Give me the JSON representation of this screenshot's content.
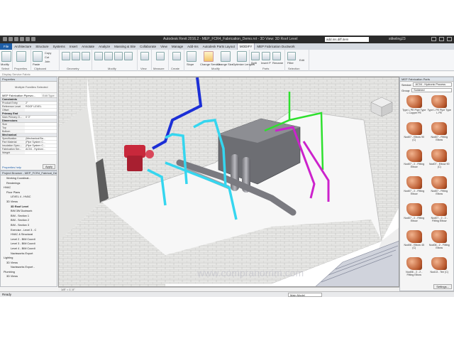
{
  "title_bar": {
    "title": "Autodesk Revit 2016.2 - MEP_FCR4_Fabrication_Demo.rvt - 3D View: 3D Roof Level",
    "search": "add.ins.diff.item",
    "user": "stikeling23"
  },
  "ribbon_tabs": [
    "File",
    "Architecture",
    "Structure",
    "Systems",
    "Insert",
    "Annotate",
    "Analyze",
    "Massing & Site",
    "Collaborate",
    "View",
    "Manage",
    "Add-Ins",
    "Autodesk Parts Layout",
    "MODIFY",
    "MEP Fabrication Ductwork"
  ],
  "ribbon": {
    "modify": "Modify",
    "copy": "Copy",
    "cut": "Cut",
    "join": "Join",
    "paste": "Paste",
    "groups": [
      "Select",
      "Properties",
      "Clipboard",
      "Geometry",
      "Modify",
      "View",
      "Measure",
      "Create",
      "Modify",
      "Parts",
      "Selection"
    ],
    "slope": "Slope",
    "change_service": "Change Service",
    "change_size": "Change Size",
    "optimize_lengths": "Optimize Lengths",
    "parts": [
      "Split",
      "Insert Points",
      "Rename Parts"
    ],
    "filter": "Filter",
    "edit": "Edit",
    "select_label": "Select"
  },
  "options_bar": "Display Service Fabric",
  "properties": {
    "title": "Properties",
    "type_selector": "Multiple Families Selected",
    "filter": "MEP Fabrication Pipewo...",
    "edit_type": "Edit Type",
    "sections": {
      "constraints": "Constraints",
      "primary_end": "Primary End",
      "dimensions": "Dimensions",
      "mechanical": "Mechanical"
    },
    "rows": [
      {
        "k": "Product Entry",
        "v": "2\""
      },
      {
        "k": "Reference Level",
        "v": "ROOF LEVEL"
      },
      {
        "k": "Offset",
        "v": ""
      }
    ],
    "primary_rows": [
      {
        "k": "Main Primary O...",
        "v": "0' 0\""
      }
    ],
    "dim_rows": [
      {
        "k": "Size",
        "v": ""
      },
      {
        "k": "Top",
        "v": ""
      },
      {
        "k": "Bottom",
        "v": ""
      }
    ],
    "mech_rows": [
      {
        "k": "Specification",
        "v": "(Mechanical Ba..."
      },
      {
        "k": "Part Material",
        "v": "(Pipe System C..."
      },
      {
        "k": "Insulation Spec...",
        "v": "(Pipe System C..."
      },
      {
        "k": "Fabrication Ser...",
        "v": "AC04 - Hydroni..."
      },
      {
        "k": "Weight",
        "v": ""
      }
    ],
    "help": "Properties help",
    "apply": "Apply"
  },
  "project_browser": {
    "title": "Project Browser - MEP_FCR4_Fabricat_Demo.rvt",
    "items": [
      "Working Coordinat...",
      "Renderings",
      "HVAC",
      "Floor Plans",
      "LEVEL 4 - HVAC",
      "3D Views",
      "3D Roof Level",
      "BIM 3W Ductwork",
      "BIM - Section 1",
      "BIM - Section 2",
      "BIM - Section 3",
      "Exercise - Level 3 - C",
      "HVAC & Structural",
      "Level 2 - BIM Coordi",
      "Level 3 - BIM Coordi",
      "Level 4 - BIM Coordi",
      "Navisworks Export",
      "Lighting",
      "3D Views",
      "Navisworks Export -",
      "Plumbing",
      "3D Views"
    ]
  },
  "fab_parts": {
    "title": "MEP Fabrication Parts",
    "service_label": "Service:",
    "service_value": "AC04 - Hydronic Process",
    "group_label": "Group:",
    "group_value": "Soldered",
    "items": [
      "Type L PE Pipe Type L Copper PE",
      "Type L PE Pipe Type L PE",
      "Nod07 - Elbow 90 (C)",
      "Nod07 - Fitting Elbow",
      "Nod07 - 2 - Fitting Elbow",
      "Nod07 - Elbow 90 (C)",
      "Nod07 - 2 - Fitting Elbow",
      "Nod07 - Fitting Elbow",
      "Nod07 - 2 - Fitting Elbow",
      "Nod07 - 2 - 2 - Fitting Elbow",
      "Nod06 - Elbow 45 (C)",
      "Nod06 - 2 - Fitting Elbow",
      "Nod06 - 2 - 2 - Fitting Elbow",
      "Nod13 - Tee (C)"
    ],
    "settings": "Settings..."
  },
  "status": {
    "left": "Ready",
    "model": "Main Model",
    "view_scale": "1/8\" = 1'-0\""
  },
  "watermark": "www.compranorrim.com",
  "colors": {
    "accent": "#1f5fa8",
    "pipe_blue": "#1c2fd6",
    "pipe_cyan": "#35d6ef",
    "pipe_green": "#2ee02e",
    "pipe_magenta": "#cc22cc",
    "pump_red": "#c8283b"
  }
}
